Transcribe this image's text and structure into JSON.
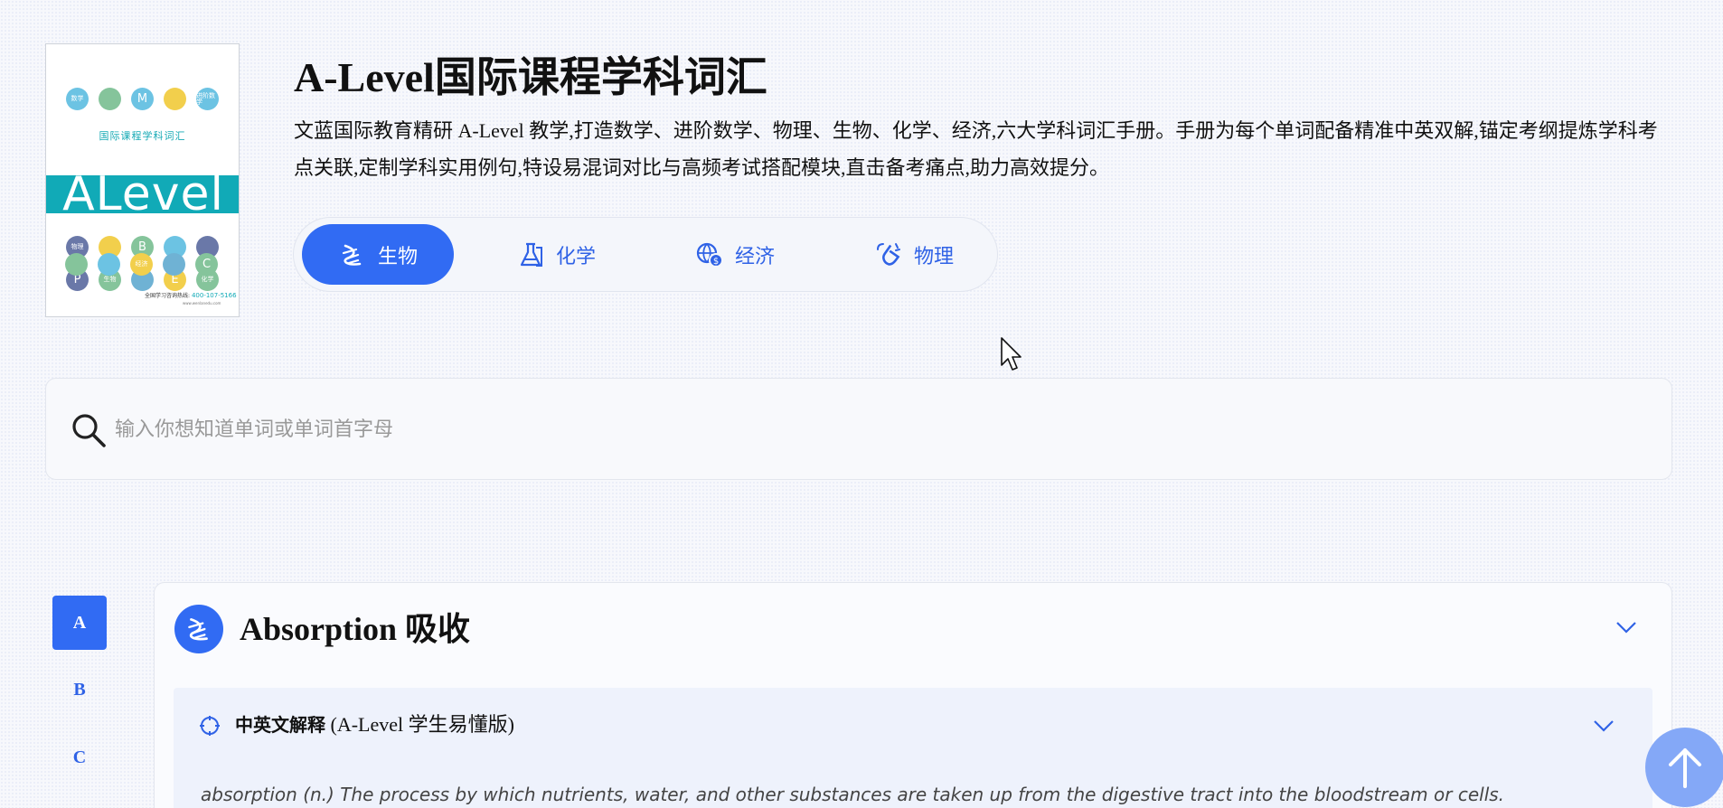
{
  "header": {
    "title": "A-Level国际课程学科词汇",
    "description": "文蓝国际教育精研 A-Level 教学,打造数学、进阶数学、物理、生物、化学、经济,六大学科词汇手册。手册为每个单词配备精准中英双解,锚定考纲提炼学科考点关联,定制学科实用例句,特设易混词对比与高频考试搭配模块,直击备考痛点,助力高效提分。"
  },
  "cover": {
    "subtitle": "国际课程学科词汇",
    "word": "ALevel",
    "phone_label": "全国学习咨询热线:",
    "phone": "400-107-5166",
    "url": "www.wenlanedu.com",
    "dots": [
      "数学",
      "",
      "M",
      "",
      "进阶数学",
      "物理",
      "",
      "B",
      "",
      "",
      "P",
      "生物",
      "",
      "E",
      "化学",
      "",
      "",
      "经济",
      "",
      "C"
    ]
  },
  "tabs": [
    {
      "label": "生物",
      "icon": "dna-icon",
      "active": true
    },
    {
      "label": "化学",
      "icon": "flask-icon",
      "active": false
    },
    {
      "label": "经济",
      "icon": "globe-coin-icon",
      "active": false
    },
    {
      "label": "物理",
      "icon": "magnet-icon",
      "active": false
    }
  ],
  "search": {
    "placeholder": "输入你想知道单词或单词首字母"
  },
  "alphabet": [
    "A",
    "B",
    "C"
  ],
  "word_card": {
    "title": "Absorption 吸收",
    "section_title_bold": "中英文解释",
    "section_title_rest": " (A-Level 学生易懂版)",
    "definition": "absorption (n.) The process by which nutrients, water, and other substances are taken up from the digestive tract into the bloodstream or cells."
  },
  "colors": {
    "accent": "#316bf3",
    "teal": "#11aab7"
  }
}
